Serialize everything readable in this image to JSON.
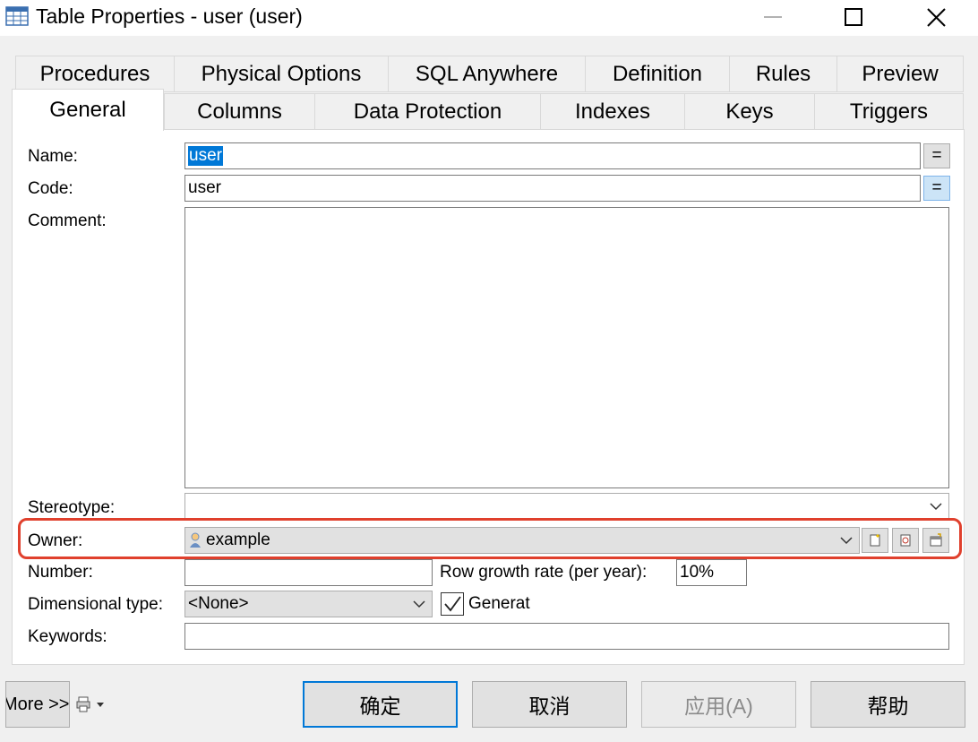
{
  "window": {
    "title": "Table Properties - user (user)",
    "icon": "table-icon"
  },
  "tabs_row1": [
    "Procedures",
    "Physical Options",
    "SQL Anywhere",
    "Definition",
    "Rules",
    "Preview"
  ],
  "tabs_row2": [
    "General",
    "Columns",
    "Data Protection",
    "Indexes",
    "Keys",
    "Triggers"
  ],
  "active_tab": "General",
  "form": {
    "name_label": "Name:",
    "name_value": "user",
    "code_label": "Code:",
    "code_value": "user",
    "eq_label": "=",
    "comment_label": "Comment:",
    "comment_value": "",
    "stereotype_label": "Stereotype:",
    "stereotype_value": "",
    "owner_label": "Owner:",
    "owner_value": "example",
    "number_label": "Number:",
    "number_value": "",
    "growth_label": "Row growth rate (per year):",
    "growth_value": "10%",
    "dimensional_label": "Dimensional type:",
    "dimensional_value": "<None>",
    "generate_label": "Generat",
    "generate_checked": true,
    "keywords_label": "Keywords:",
    "keywords_value": ""
  },
  "buttons": {
    "more": "More >>",
    "ok": "确定",
    "cancel": "取消",
    "apply": "应用(A)",
    "help": "帮助"
  },
  "colors": {
    "highlight": "#e0402d",
    "selection": "#0078d7",
    "accent_border": "#0078d7"
  }
}
